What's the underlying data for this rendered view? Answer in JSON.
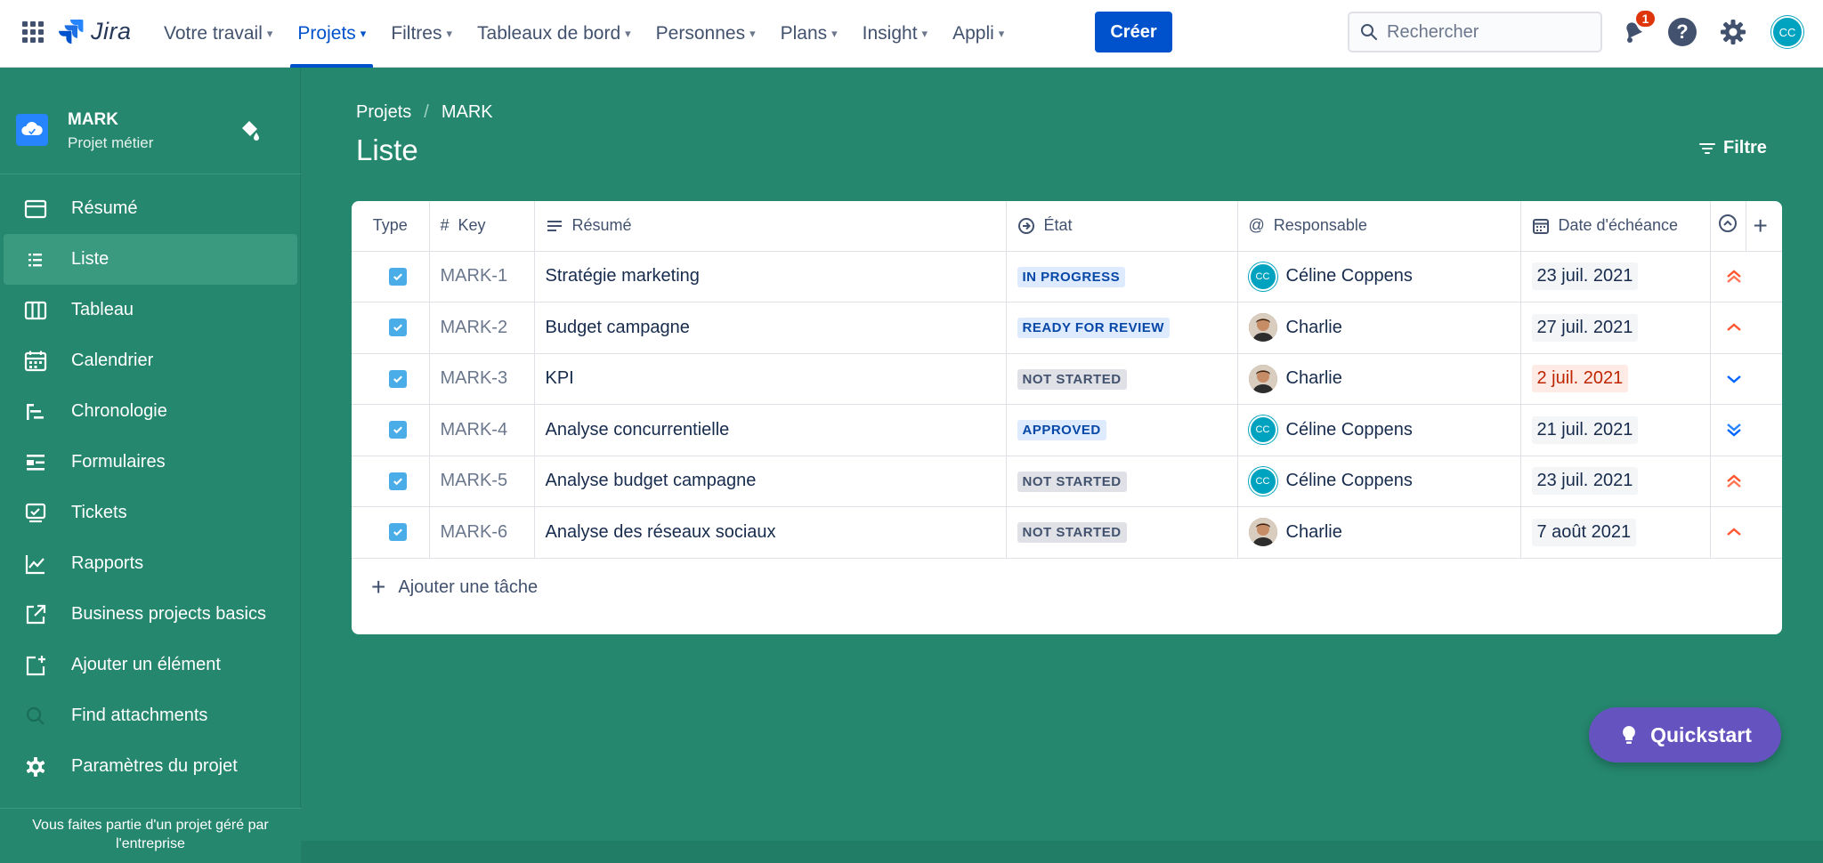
{
  "topnav": {
    "logo_text": "Jira",
    "items": [
      {
        "label": "Votre travail"
      },
      {
        "label": "Projets"
      },
      {
        "label": "Filtres"
      },
      {
        "label": "Tableaux de bord"
      },
      {
        "label": "Personnes"
      },
      {
        "label": "Plans"
      },
      {
        "label": "Insight"
      },
      {
        "label": "Appli"
      }
    ],
    "create_label": "Créer",
    "search_placeholder": "Rechercher",
    "notification_count": "1",
    "help_label": "?",
    "avatar_initials": "CC"
  },
  "sidebar": {
    "project_name": "MARK",
    "project_type": "Projet métier",
    "items": [
      {
        "label": "Résumé"
      },
      {
        "label": "Liste"
      },
      {
        "label": "Tableau"
      },
      {
        "label": "Calendrier"
      },
      {
        "label": "Chronologie"
      },
      {
        "label": "Formulaires"
      },
      {
        "label": "Tickets"
      },
      {
        "label": "Rapports"
      },
      {
        "label": "Business projects basics"
      },
      {
        "label": "Ajouter un élément"
      },
      {
        "label": "Find attachments"
      },
      {
        "label": "Paramètres du projet"
      }
    ],
    "footer": "Vous faites partie d'un projet géré par l'entreprise"
  },
  "main": {
    "breadcrumb": [
      "Projets",
      "MARK"
    ],
    "breadcrumb_sep": "/",
    "title": "Liste",
    "filter_label": "Filtre",
    "columns": {
      "type": "Type",
      "key": "Key",
      "summary": "Résumé",
      "status": "État",
      "assignee": "Responsable",
      "due": "Date d'échéance"
    },
    "rows": [
      {
        "key": "MARK-1",
        "summary": "Stratégie marketing",
        "status": "IN PROGRESS",
        "assignee": "Céline Coppens",
        "assignee_initials": "CC",
        "due": "23 juil. 2021",
        "priority": "highest"
      },
      {
        "key": "MARK-2",
        "summary": "Budget campagne",
        "status": "READY FOR REVIEW",
        "assignee": "Charlie",
        "assignee_initials": "",
        "due": "27 juil. 2021",
        "priority": "high"
      },
      {
        "key": "MARK-3",
        "summary": "KPI",
        "status": "NOT STARTED",
        "assignee": "Charlie",
        "assignee_initials": "",
        "due": "2 juil. 2021",
        "priority": "low"
      },
      {
        "key": "MARK-4",
        "summary": "Analyse concurrentielle",
        "status": "APPROVED",
        "assignee": "Céline Coppens",
        "assignee_initials": "CC",
        "due": "21 juil. 2021",
        "priority": "lowest"
      },
      {
        "key": "MARK-5",
        "summary": "Analyse budget campagne",
        "status": "NOT STARTED",
        "assignee": "Céline Coppens",
        "assignee_initials": "CC",
        "due": "23 juil. 2021",
        "priority": "highest"
      },
      {
        "key": "MARK-6",
        "summary": "Analyse des réseaux sociaux",
        "status": "NOT STARTED",
        "assignee": "Charlie",
        "assignee_initials": "",
        "due": "7 août 2021",
        "priority": "high"
      }
    ],
    "add_task_label": "Ajouter une tâche"
  },
  "quickstart_label": "Quickstart",
  "colors": {
    "brand": "#0052cc",
    "background": "#25876e",
    "quickstart": "#6554c0",
    "priority_high": "#ff5630",
    "priority_low": "#2684ff"
  }
}
